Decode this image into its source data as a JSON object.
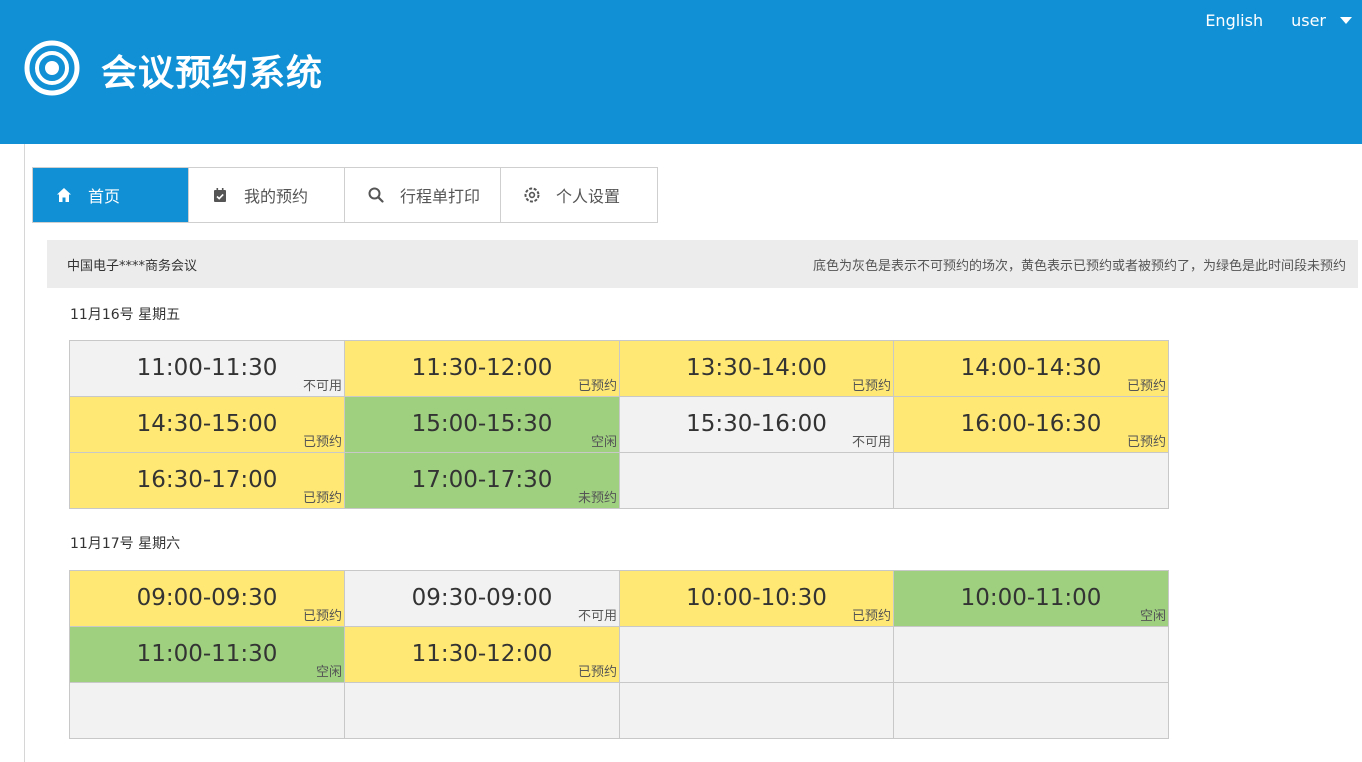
{
  "header": {
    "title": "会议预约系统",
    "lang_link": "English",
    "user_label": "user"
  },
  "tabs": [
    {
      "label": "首页",
      "icon": "home-icon",
      "active": true
    },
    {
      "label": "我的预约",
      "icon": "calendar-check-icon",
      "active": false
    },
    {
      "label": "行程单打印",
      "icon": "search-icon",
      "active": false
    },
    {
      "label": "个人设置",
      "icon": "gear-icon",
      "active": false
    }
  ],
  "info": {
    "meeting_name": "中国电子****商务会议",
    "legend_hint": "底色为灰色是表示不可预约的场次，黄色表示已预约或者被预约了，为绿色是此时间段未预约"
  },
  "days": [
    {
      "label": "11月16号 星期五",
      "slots": [
        {
          "time": "11:00-11:30",
          "status": "不可用",
          "state": "na"
        },
        {
          "time": "11:30-12:00",
          "status": "已预约",
          "state": "booked"
        },
        {
          "time": "13:30-14:00",
          "status": "已预约",
          "state": "booked"
        },
        {
          "time": "14:00-14:30",
          "status": "已预约",
          "state": "booked"
        },
        {
          "time": "14:30-15:00",
          "status": "已预约",
          "state": "booked"
        },
        {
          "time": "15:00-15:30",
          "status": "空闲",
          "state": "free"
        },
        {
          "time": "15:30-16:00",
          "status": "不可用",
          "state": "na"
        },
        {
          "time": "16:00-16:30",
          "status": "已预约",
          "state": "booked"
        },
        {
          "time": "16:30-17:00",
          "status": "已预约",
          "state": "booked"
        },
        {
          "time": "17:00-17:30",
          "status": "未预约",
          "state": "free"
        },
        {
          "time": "",
          "status": "",
          "state": "empty"
        },
        {
          "time": "",
          "status": "",
          "state": "empty"
        }
      ]
    },
    {
      "label": "11月17号 星期六",
      "slots": [
        {
          "time": "09:00-09:30",
          "status": "已预约",
          "state": "booked"
        },
        {
          "time": "09:30-09:00",
          "status": "不可用",
          "state": "na"
        },
        {
          "time": "10:00-10:30",
          "status": "已预约",
          "state": "booked"
        },
        {
          "time": "10:00-11:00",
          "status": "空闲",
          "state": "free"
        },
        {
          "time": "11:00-11:30",
          "status": "空闲",
          "state": "free"
        },
        {
          "time": "11:30-12:00",
          "status": "已预约",
          "state": "booked"
        },
        {
          "time": "",
          "status": "",
          "state": "empty"
        },
        {
          "time": "",
          "status": "",
          "state": "empty"
        },
        {
          "time": "",
          "status": "",
          "state": "empty"
        },
        {
          "time": "",
          "status": "",
          "state": "empty"
        },
        {
          "time": "",
          "status": "",
          "state": "empty"
        },
        {
          "time": "",
          "status": "",
          "state": "empty"
        }
      ]
    }
  ],
  "colors": {
    "brand": "#1190d5",
    "booked": "#ffe873",
    "free": "#9ed080",
    "unavailable": "#f2f2f2"
  }
}
